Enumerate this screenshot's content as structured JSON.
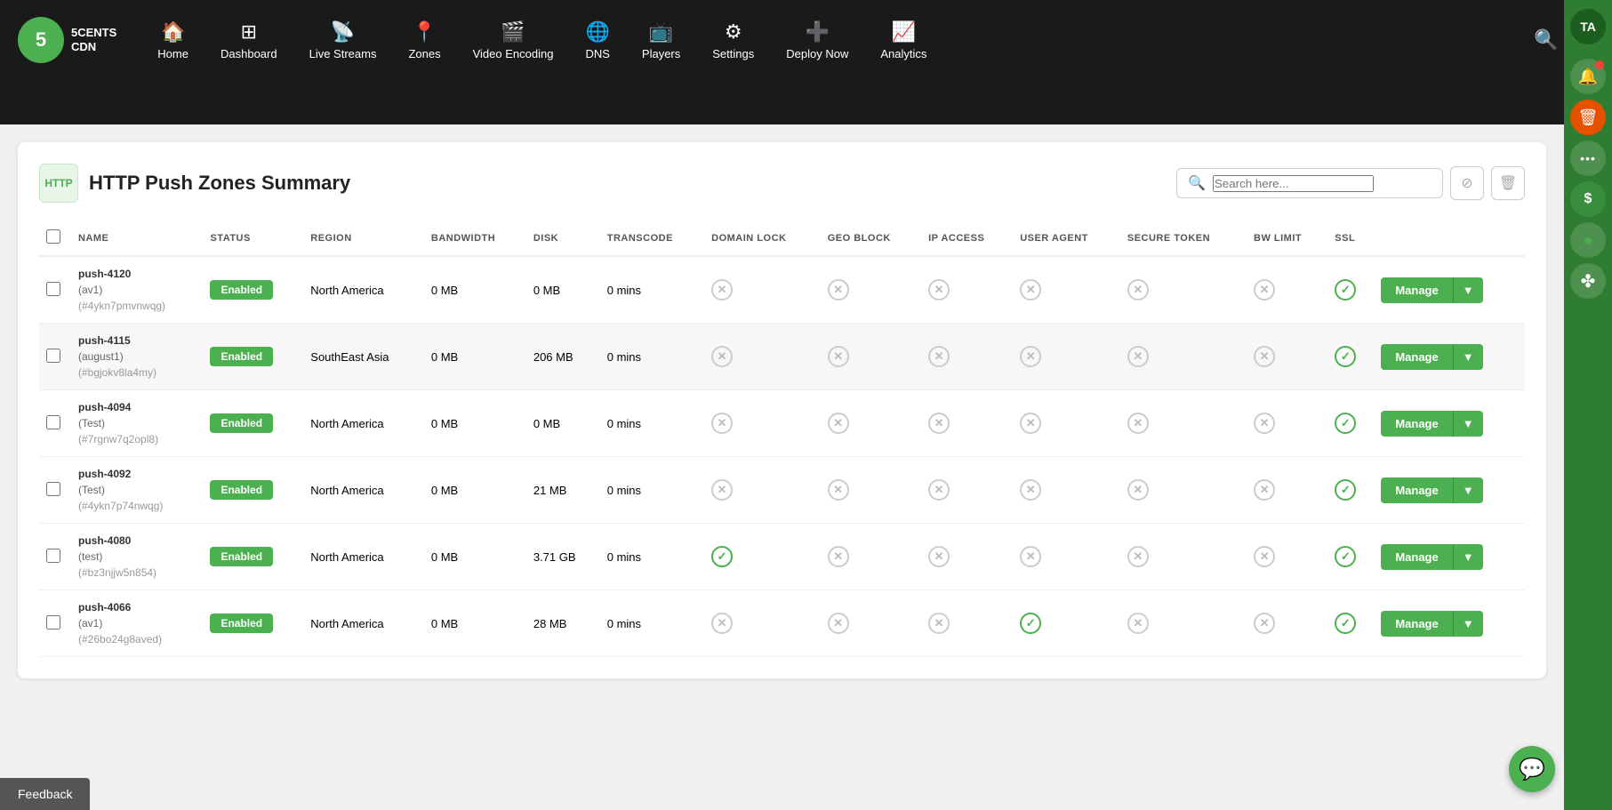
{
  "nav": {
    "logo": {
      "number": "5",
      "text": "5CENTS\nCDN"
    },
    "items": [
      {
        "id": "home",
        "label": "Home",
        "icon": "🏠"
      },
      {
        "id": "dashboard",
        "label": "Dashboard",
        "icon": "⊞"
      },
      {
        "id": "live-streams",
        "label": "Live Streams",
        "icon": "📡"
      },
      {
        "id": "zones",
        "label": "Zones",
        "icon": "📍"
      },
      {
        "id": "video-encoding",
        "label": "Video Encoding",
        "icon": "🎬"
      },
      {
        "id": "dns",
        "label": "DNS",
        "icon": "🌐"
      },
      {
        "id": "players",
        "label": "Players",
        "icon": "📺"
      },
      {
        "id": "settings",
        "label": "Settings",
        "icon": "⚙"
      },
      {
        "id": "deploy-now",
        "label": "Deploy Now",
        "icon": "➕"
      },
      {
        "id": "analytics",
        "label": "Analytics",
        "icon": "📈"
      }
    ]
  },
  "page": {
    "title": "HTTP Push Zones Summary",
    "icon_label": "HTTP",
    "search_placeholder": "Search here..."
  },
  "table": {
    "columns": [
      "NAME",
      "STATUS",
      "REGION",
      "BANDWIDTH",
      "DISK",
      "TRANSCODE",
      "DOMAIN LOCK",
      "GEO BLOCK",
      "IP ACCESS",
      "USER AGENT",
      "SECURE TOKEN",
      "BW LIMIT",
      "SSL"
    ],
    "rows": [
      {
        "name_main": "push-4120",
        "name_sub": "(av1)",
        "name_hash": "(#4ykn7pmvnwqg)",
        "status": "Enabled",
        "region": "North America",
        "bandwidth": "0 MB",
        "disk": "0 MB",
        "transcode": "0 mins",
        "domain_lock": "x",
        "geo_block": "x",
        "ip_access": "x",
        "user_agent": "x",
        "secure_token": "x",
        "bw_limit": "x",
        "ssl": "check",
        "highlighted": false
      },
      {
        "name_main": "push-4115",
        "name_sub": "(august1)",
        "name_hash": "(#bgjokv8la4my)",
        "status": "Enabled",
        "region": "SouthEast Asia",
        "bandwidth": "0 MB",
        "disk": "206 MB",
        "transcode": "0 mins",
        "domain_lock": "x",
        "geo_block": "x",
        "ip_access": "x",
        "user_agent": "x",
        "secure_token": "x",
        "bw_limit": "x",
        "ssl": "check",
        "highlighted": true
      },
      {
        "name_main": "push-4094",
        "name_sub": "(Test)",
        "name_hash": "(#7rgnw7q2opl8)",
        "status": "Enabled",
        "region": "North America",
        "bandwidth": "0 MB",
        "disk": "0 MB",
        "transcode": "0 mins",
        "domain_lock": "x",
        "geo_block": "x",
        "ip_access": "x",
        "user_agent": "x",
        "secure_token": "x",
        "bw_limit": "x",
        "ssl": "check",
        "highlighted": false
      },
      {
        "name_main": "push-4092",
        "name_sub": "(Test)",
        "name_hash": "(#4ykn7p74nwqg)",
        "status": "Enabled",
        "region": "North America",
        "bandwidth": "0 MB",
        "disk": "21 MB",
        "transcode": "0 mins",
        "domain_lock": "x",
        "geo_block": "x",
        "ip_access": "x",
        "user_agent": "x",
        "secure_token": "x",
        "bw_limit": "x",
        "ssl": "check",
        "highlighted": false
      },
      {
        "name_main": "push-4080",
        "name_sub": "(test)",
        "name_hash": "(#bz3njjw5n854)",
        "status": "Enabled",
        "region": "North America",
        "bandwidth": "0 MB",
        "disk": "3.71 GB",
        "transcode": "0 mins",
        "domain_lock": "check",
        "geo_block": "x",
        "ip_access": "x",
        "user_agent": "x",
        "secure_token": "x",
        "bw_limit": "x",
        "ssl": "check",
        "highlighted": false
      },
      {
        "name_main": "push-4066",
        "name_sub": "(av1)",
        "name_hash": "(#26bo24g8aved)",
        "status": "Enabled",
        "region": "North America",
        "bandwidth": "0 MB",
        "disk": "28 MB",
        "transcode": "0 mins",
        "domain_lock": "x",
        "geo_block": "x",
        "ip_access": "x",
        "user_agent": "check",
        "secure_token": "x",
        "bw_limit": "x",
        "ssl": "check",
        "highlighted": false
      }
    ],
    "manage_label": "Manage"
  },
  "sidebar": {
    "avatar": "TA",
    "buttons": [
      {
        "id": "notifications",
        "icon": "🔔",
        "has_badge": true
      },
      {
        "id": "trash",
        "icon": "🗑",
        "style": "orange"
      },
      {
        "id": "more",
        "icon": "···"
      },
      {
        "id": "dollar",
        "icon": "$",
        "style": "dollar"
      },
      {
        "id": "status-dot",
        "icon": "●",
        "style": "green-circle"
      },
      {
        "id": "grid",
        "icon": "✤"
      }
    ]
  },
  "chat_fab_icon": "💬",
  "feedback_label": "Feedback"
}
